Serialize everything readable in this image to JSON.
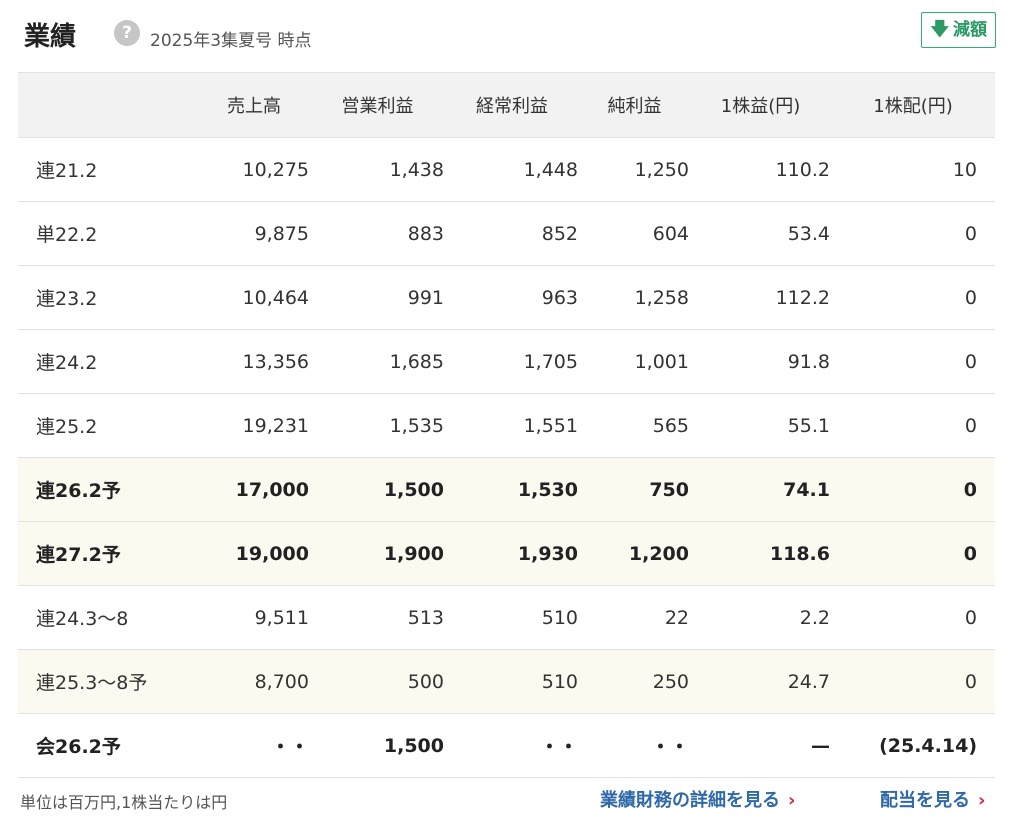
{
  "header": {
    "title": "業績",
    "help_icon": "?",
    "as_of": "2025年3集夏号 時点",
    "badge_arrow": "🡇",
    "badge_label": "減額",
    "badge_color": "#2b9a66"
  },
  "table": {
    "columns": [
      "",
      "売上高",
      "営業利益",
      "経常利益",
      "純利益",
      "1株益(円)",
      "1株配(円)"
    ],
    "rows": [
      {
        "label": "連21.2",
        "values": [
          "10,275",
          "1,438",
          "1,448",
          "1,250",
          "110.2",
          "10"
        ]
      },
      {
        "label": "単22.2",
        "values": [
          "9,875",
          "883",
          "852",
          "604",
          "53.4",
          "0"
        ]
      },
      {
        "label": "連23.2",
        "values": [
          "10,464",
          "991",
          "963",
          "1,258",
          "112.2",
          "0"
        ]
      },
      {
        "label": "連24.2",
        "values": [
          "13,356",
          "1,685",
          "1,705",
          "1,001",
          "91.8",
          "0"
        ]
      },
      {
        "label": "連25.2",
        "values": [
          "19,231",
          "1,535",
          "1,551",
          "565",
          "55.1",
          "0"
        ]
      },
      {
        "label": "連26.2予",
        "values": [
          "17,000",
          "1,500",
          "1,530",
          "750",
          "74.1",
          "0"
        ]
      },
      {
        "label": "連27.2予",
        "values": [
          "19,000",
          "1,900",
          "1,930",
          "1,200",
          "118.6",
          "0"
        ]
      },
      {
        "label": "連24.3〜8",
        "values": [
          "9,511",
          "513",
          "510",
          "22",
          "2.2",
          "0"
        ]
      },
      {
        "label": "連25.3〜8予",
        "values": [
          "8,700",
          "500",
          "510",
          "250",
          "24.7",
          "0"
        ]
      },
      {
        "label": "会26.2予",
        "values": [
          "・・",
          "1,500",
          "・・",
          "・・",
          "—",
          "(25.4.14)"
        ]
      }
    ]
  },
  "footer": {
    "unit_note": "単位は百万円,1株当たりは円",
    "link_details": "業績財務の詳細を見る",
    "link_dividend": "配当を見る",
    "chevron": "›"
  }
}
